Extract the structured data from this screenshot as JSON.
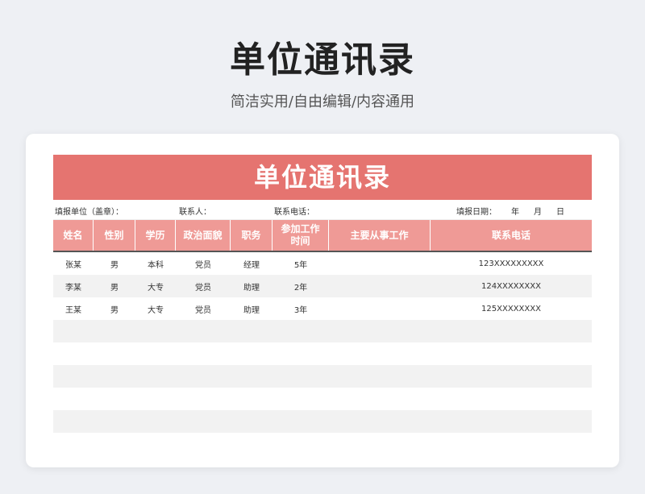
{
  "page": {
    "title": "单位通讯录",
    "subtitle": "简洁实用/自由编辑/内容通用"
  },
  "sheet": {
    "banner": "单位通讯录",
    "info": {
      "unit_label": "填报单位（盖章）：",
      "contact_label": "联系人：",
      "phone_label": "联系电话：",
      "date_label": "填报日期：",
      "year": "年",
      "month": "月",
      "day": "日"
    },
    "columns": [
      "姓名",
      "性别",
      "学历",
      "政治面貌",
      "职务",
      "参加工作时间",
      "主要从事工作",
      "联系电话"
    ],
    "rows": [
      {
        "name": "张某",
        "gender": "男",
        "education": "本科",
        "political": "党员",
        "position": "经理",
        "work_time": "5年",
        "main_work": "",
        "phone": "123XXXXXXXXX"
      },
      {
        "name": "李某",
        "gender": "男",
        "education": "大专",
        "political": "党员",
        "position": "助理",
        "work_time": "2年",
        "main_work": "",
        "phone": "124XXXXXXXX"
      },
      {
        "name": "王某",
        "gender": "男",
        "education": "大专",
        "political": "党员",
        "position": "助理",
        "work_time": "3年",
        "main_work": "",
        "phone": "125XXXXXXXX"
      },
      {
        "name": "",
        "gender": "",
        "education": "",
        "political": "",
        "position": "",
        "work_time": "",
        "main_work": "",
        "phone": ""
      },
      {
        "name": "",
        "gender": "",
        "education": "",
        "political": "",
        "position": "",
        "work_time": "",
        "main_work": "",
        "phone": ""
      },
      {
        "name": "",
        "gender": "",
        "education": "",
        "political": "",
        "position": "",
        "work_time": "",
        "main_work": "",
        "phone": ""
      },
      {
        "name": "",
        "gender": "",
        "education": "",
        "political": "",
        "position": "",
        "work_time": "",
        "main_work": "",
        "phone": ""
      },
      {
        "name": "",
        "gender": "",
        "education": "",
        "political": "",
        "position": "",
        "work_time": "",
        "main_work": "",
        "phone": ""
      },
      {
        "name": "",
        "gender": "",
        "education": "",
        "political": "",
        "position": "",
        "work_time": "",
        "main_work": "",
        "phone": ""
      }
    ]
  }
}
